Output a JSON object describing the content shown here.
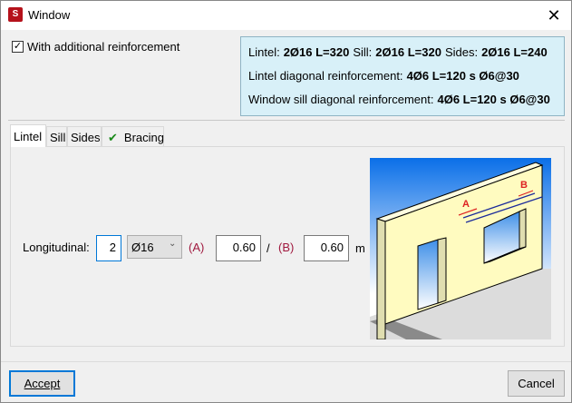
{
  "window": {
    "title": "Window",
    "app_icon_text": "S",
    "close": "✕"
  },
  "options": {
    "additional_reinforcement_label": "With additional reinforcement",
    "checked_mark": "✓"
  },
  "summary": {
    "lintel_label": "Lintel:",
    "lintel_value": "2Ø16 L=320",
    "sill_label": "Sill:",
    "sill_value": "2Ø16 L=320",
    "sides_label": "Sides:",
    "sides_value": "2Ø16 L=240",
    "lintel_diag_label": "Lintel diagonal reinforcement:",
    "lintel_diag_value": "4Ø6 L=120 s Ø6@30",
    "sill_diag_label": "Window sill diagonal reinforcement:",
    "sill_diag_value": "4Ø6 L=120 s Ø6@30"
  },
  "tabs": [
    {
      "label": "Lintel"
    },
    {
      "label": "Sill"
    },
    {
      "label": "Sides"
    },
    {
      "label": "Bracing",
      "check": "✔"
    }
  ],
  "lintel": {
    "longitudinal_label": "Longitudinal:",
    "count": "2",
    "diameter": "Ø16",
    "a_label": "(A)",
    "a_value": "0.60",
    "separator": "/",
    "b_label": "(B)",
    "b_value": "0.60",
    "unit": "m"
  },
  "drawing": {
    "label_a": "A",
    "label_b": "B"
  },
  "buttons": {
    "accept": "Accept",
    "cancel": "Cancel"
  }
}
